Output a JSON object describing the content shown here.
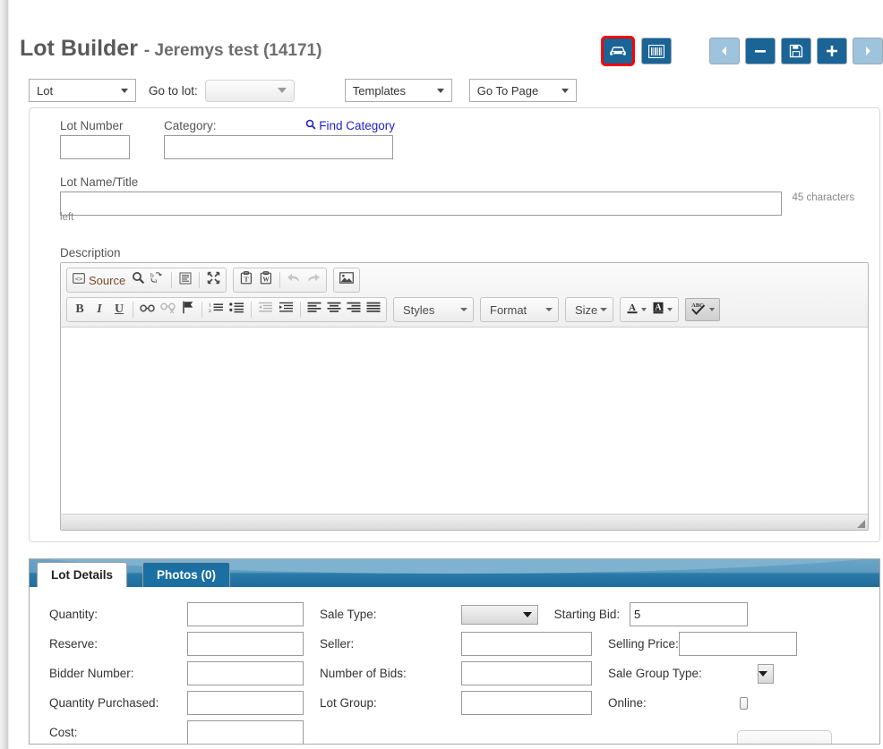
{
  "header": {
    "title_main": "Lot Builder",
    "title_sub": "- Jeremys test (14171)",
    "actions": [
      {
        "name": "vehicle-button",
        "icon": "car-icon",
        "highlighted": true
      },
      {
        "name": "barcode-button",
        "icon": "barcode-icon",
        "highlighted": false
      },
      {
        "name": "previous-button",
        "icon": "triangle-left-icon",
        "state": "disabled"
      },
      {
        "name": "remove-button",
        "icon": "minus-icon",
        "state": "enabled"
      },
      {
        "name": "save-button",
        "icon": "floppy-disk-icon",
        "state": "enabled"
      },
      {
        "name": "add-button",
        "icon": "plus-icon",
        "state": "enabled"
      },
      {
        "name": "next-button",
        "icon": "triangle-right-icon",
        "state": "disabled"
      }
    ]
  },
  "toolbar": {
    "lot_select_value": "Lot",
    "goto_lot_label": "Go to lot:",
    "goto_lot_value": "",
    "templates_value": "Templates",
    "go_to_page_value": "Go To Page"
  },
  "form": {
    "lot_number_label": "Lot Number",
    "lot_number_value": "",
    "category_label": "Category:",
    "category_value": "",
    "find_category_link": "Find Category",
    "find_category_icon": "search-icon",
    "lot_name_label": "Lot Name/Title",
    "lot_name_value": "",
    "characters_left": "45 characters left",
    "description_label": "Description"
  },
  "editor": {
    "source_label": "Source",
    "styles_label": "Styles",
    "format_label": "Format",
    "size_label": "Size",
    "content": "",
    "toolbar_row1": [
      {
        "name": "source-button",
        "icon": "source-code-icon",
        "label": "Source"
      },
      {
        "name": "find-button",
        "icon": "magnifier-icon"
      },
      {
        "name": "replace-button",
        "icon": "find-replace-icon"
      },
      {
        "name": "select-all-button",
        "icon": "select-all-icon"
      },
      {
        "name": "maximize-button",
        "icon": "maximize-icon"
      },
      {
        "name": "paste-as-text-button",
        "icon": "paste-text-icon"
      },
      {
        "name": "paste-from-word-button",
        "icon": "paste-word-icon"
      },
      {
        "name": "undo-button",
        "icon": "undo-arrow-icon",
        "state": "disabled"
      },
      {
        "name": "redo-button",
        "icon": "redo-arrow-icon",
        "state": "disabled"
      },
      {
        "name": "image-button",
        "icon": "image-icon"
      }
    ],
    "toolbar_row2": [
      {
        "name": "bold-button",
        "icon": "bold-icon"
      },
      {
        "name": "italic-button",
        "icon": "italic-icon"
      },
      {
        "name": "underline-button",
        "icon": "underline-icon"
      },
      {
        "name": "link-button",
        "icon": "link-icon"
      },
      {
        "name": "unlink-button",
        "icon": "unlink-icon",
        "state": "disabled"
      },
      {
        "name": "anchor-button",
        "icon": "flag-icon"
      },
      {
        "name": "numbered-list-button",
        "icon": "numbered-list-icon"
      },
      {
        "name": "bulleted-list-button",
        "icon": "bulleted-list-icon"
      },
      {
        "name": "outdent-button",
        "icon": "outdent-icon",
        "state": "disabled"
      },
      {
        "name": "indent-button",
        "icon": "indent-icon"
      },
      {
        "name": "align-left-button",
        "icon": "align-left-icon"
      },
      {
        "name": "align-center-button",
        "icon": "align-center-icon"
      },
      {
        "name": "align-right-button",
        "icon": "align-right-icon"
      },
      {
        "name": "justify-button",
        "icon": "align-justify-icon"
      },
      {
        "name": "text-color-button",
        "icon": "text-color-icon"
      },
      {
        "name": "background-color-button",
        "icon": "background-color-icon"
      },
      {
        "name": "spellcheck-button",
        "icon": "spellcheck-abc-icon",
        "state": "active"
      }
    ]
  },
  "tabs": [
    {
      "label": "Lot Details",
      "active": true
    },
    {
      "label": "Photos (0)",
      "active": false
    }
  ],
  "lot_details": {
    "col1": [
      {
        "label": "Quantity:",
        "value": "",
        "control": "text"
      },
      {
        "label": "Reserve:",
        "value": "",
        "control": "text"
      },
      {
        "label": "Bidder Number:",
        "value": "",
        "control": "text"
      },
      {
        "label": "Quantity Purchased:",
        "value": "",
        "control": "text"
      },
      {
        "label": "Cost:",
        "value": "",
        "control": "text"
      }
    ],
    "col2": [
      {
        "label": "Sale Type:",
        "value": "",
        "control": "select"
      },
      {
        "label": "Seller:",
        "value": "",
        "control": "text"
      },
      {
        "label": "Number of Bids:",
        "value": "",
        "control": "text"
      },
      {
        "label": "Lot Group:",
        "value": "",
        "control": "text"
      }
    ],
    "col3": [
      {
        "label": "Starting Bid:",
        "value": "5",
        "control": "text"
      },
      {
        "label": "Selling Price:",
        "value": "",
        "control": "text"
      },
      {
        "label": "Sale Group Type:",
        "value": "",
        "control": "select"
      },
      {
        "label": "Online:",
        "value": "",
        "control": "checkbox",
        "checked": false
      }
    ]
  },
  "colors": {
    "accent_blue": "#1a6496",
    "tab_blue": "#1a6fa3",
    "highlight_red": "#ff0000",
    "link_blue": "#2222cc",
    "title_gray": "#5a5a5a"
  }
}
